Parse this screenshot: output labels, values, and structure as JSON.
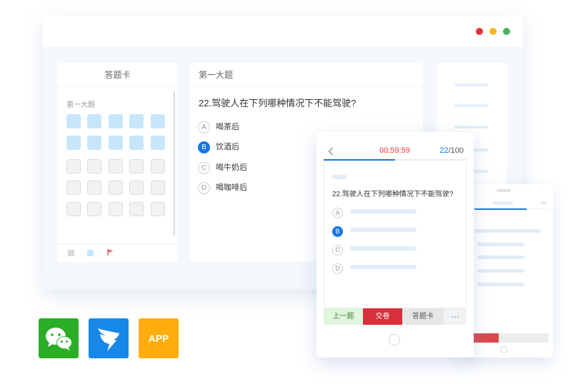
{
  "window": {
    "dot_colors": [
      "#e1373b",
      "#f2b81e",
      "#4cb25f"
    ]
  },
  "answer_card": {
    "title": "答题卡",
    "section": "第一大题",
    "done_color": "#c8e6fb",
    "todo_color": "#f2f2f2"
  },
  "question": {
    "section": "第一大题",
    "text": "22.驾驶人在下列哪种情况下不能驾驶?",
    "options": [
      {
        "letter": "A",
        "text": "喝茶后",
        "selected": false
      },
      {
        "letter": "B",
        "text": "饮酒后",
        "selected": true
      },
      {
        "letter": "C",
        "text": "喝牛奶后",
        "selected": false
      },
      {
        "letter": "D",
        "text": "喝咖啡后",
        "selected": false
      }
    ]
  },
  "tablet": {
    "back_icon": "chevron-left-icon",
    "timer": "00:59:59",
    "current": "22",
    "total": "/100",
    "progress": 0.5,
    "question": "22.驾驶人在下列哪种情况下不能驾驶?",
    "option_letters": [
      "A",
      "B",
      "C",
      "D"
    ],
    "selected": "B",
    "buttons": {
      "prev": "上一题",
      "submit": "交卷",
      "card": "答题卡",
      "more": "···"
    },
    "colors": {
      "timer": "#e53935",
      "accent": "#1677e5",
      "prev_bg": "#dff5dc",
      "submit_bg": "#d6303a"
    }
  },
  "platforms": [
    {
      "name": "wechat",
      "icon": "wechat-icon",
      "color": "#2aae25",
      "label": ""
    },
    {
      "name": "dingtalk",
      "icon": "dingtalk-icon",
      "color": "#1787ea",
      "label": ""
    },
    {
      "name": "app",
      "icon": "app-icon",
      "color": "#ffad0a",
      "label": "APP"
    }
  ]
}
